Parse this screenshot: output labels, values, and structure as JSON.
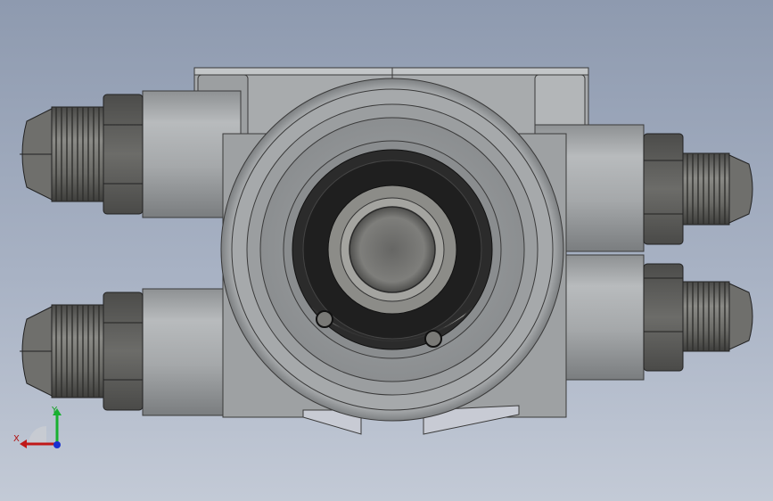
{
  "viewport": {
    "background_top": "#8e9aaf",
    "background_bottom": "#c3cad6"
  },
  "model": {
    "fittings": [
      {
        "id": "fitting-left-top"
      },
      {
        "id": "fitting-left-bottom"
      },
      {
        "id": "fitting-right-top"
      },
      {
        "id": "fitting-right-bottom"
      }
    ],
    "colors": {
      "body": "#9fa2a4",
      "body_light": "#b9bcbe",
      "body_dark": "#6f7274",
      "hex_nut": "#5a5a58",
      "bore": "#2a2a2a"
    }
  },
  "triad": {
    "x_label": "X",
    "y_label": "Y",
    "x_color": "#c01818",
    "y_color": "#18b030",
    "z_color": "#1830d0"
  }
}
